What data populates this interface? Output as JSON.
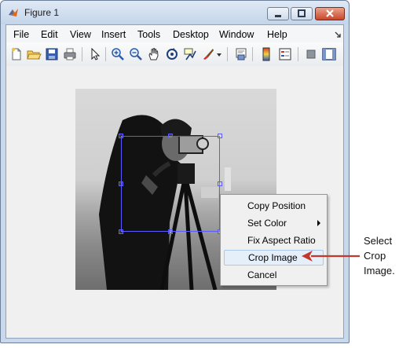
{
  "window": {
    "title": "Figure 1"
  },
  "menubar": {
    "items": [
      {
        "label": "File"
      },
      {
        "label": "Edit"
      },
      {
        "label": "View"
      },
      {
        "label": "Insert"
      },
      {
        "label": "Tools"
      },
      {
        "label": "Desktop"
      },
      {
        "label": "Window"
      },
      {
        "label": "Help"
      }
    ]
  },
  "toolbar": {
    "buttons": [
      {
        "icon": "new-figure-icon"
      },
      {
        "icon": "open-file-icon"
      },
      {
        "icon": "save-icon"
      },
      {
        "icon": "print-icon"
      },
      {
        "icon": "edit-plot-icon"
      },
      {
        "icon": "zoom-in-icon"
      },
      {
        "icon": "zoom-out-icon"
      },
      {
        "icon": "pan-icon"
      },
      {
        "icon": "rotate-3d-icon"
      },
      {
        "icon": "data-cursor-icon"
      },
      {
        "icon": "brush-icon"
      },
      {
        "icon": "link-plot-icon"
      },
      {
        "icon": "colorbar-icon"
      },
      {
        "icon": "legend-icon"
      },
      {
        "icon": "hide-plot-tools-icon"
      },
      {
        "icon": "show-plot-tools-icon"
      }
    ]
  },
  "context_menu": {
    "items": [
      {
        "label": "Copy Position"
      },
      {
        "label": "Set Color",
        "has_submenu": true
      },
      {
        "label": "Fix Aspect Ratio"
      },
      {
        "label": "Crop Image",
        "highlighted": true
      },
      {
        "label": "Cancel"
      }
    ]
  },
  "callout": {
    "line1": "Select",
    "line2": "Crop",
    "line3": "Image.",
    "arrow_color": "#c0392b"
  },
  "colors": {
    "roi_outline": "#5a5aff",
    "menu_highlight": "#e5effa"
  }
}
